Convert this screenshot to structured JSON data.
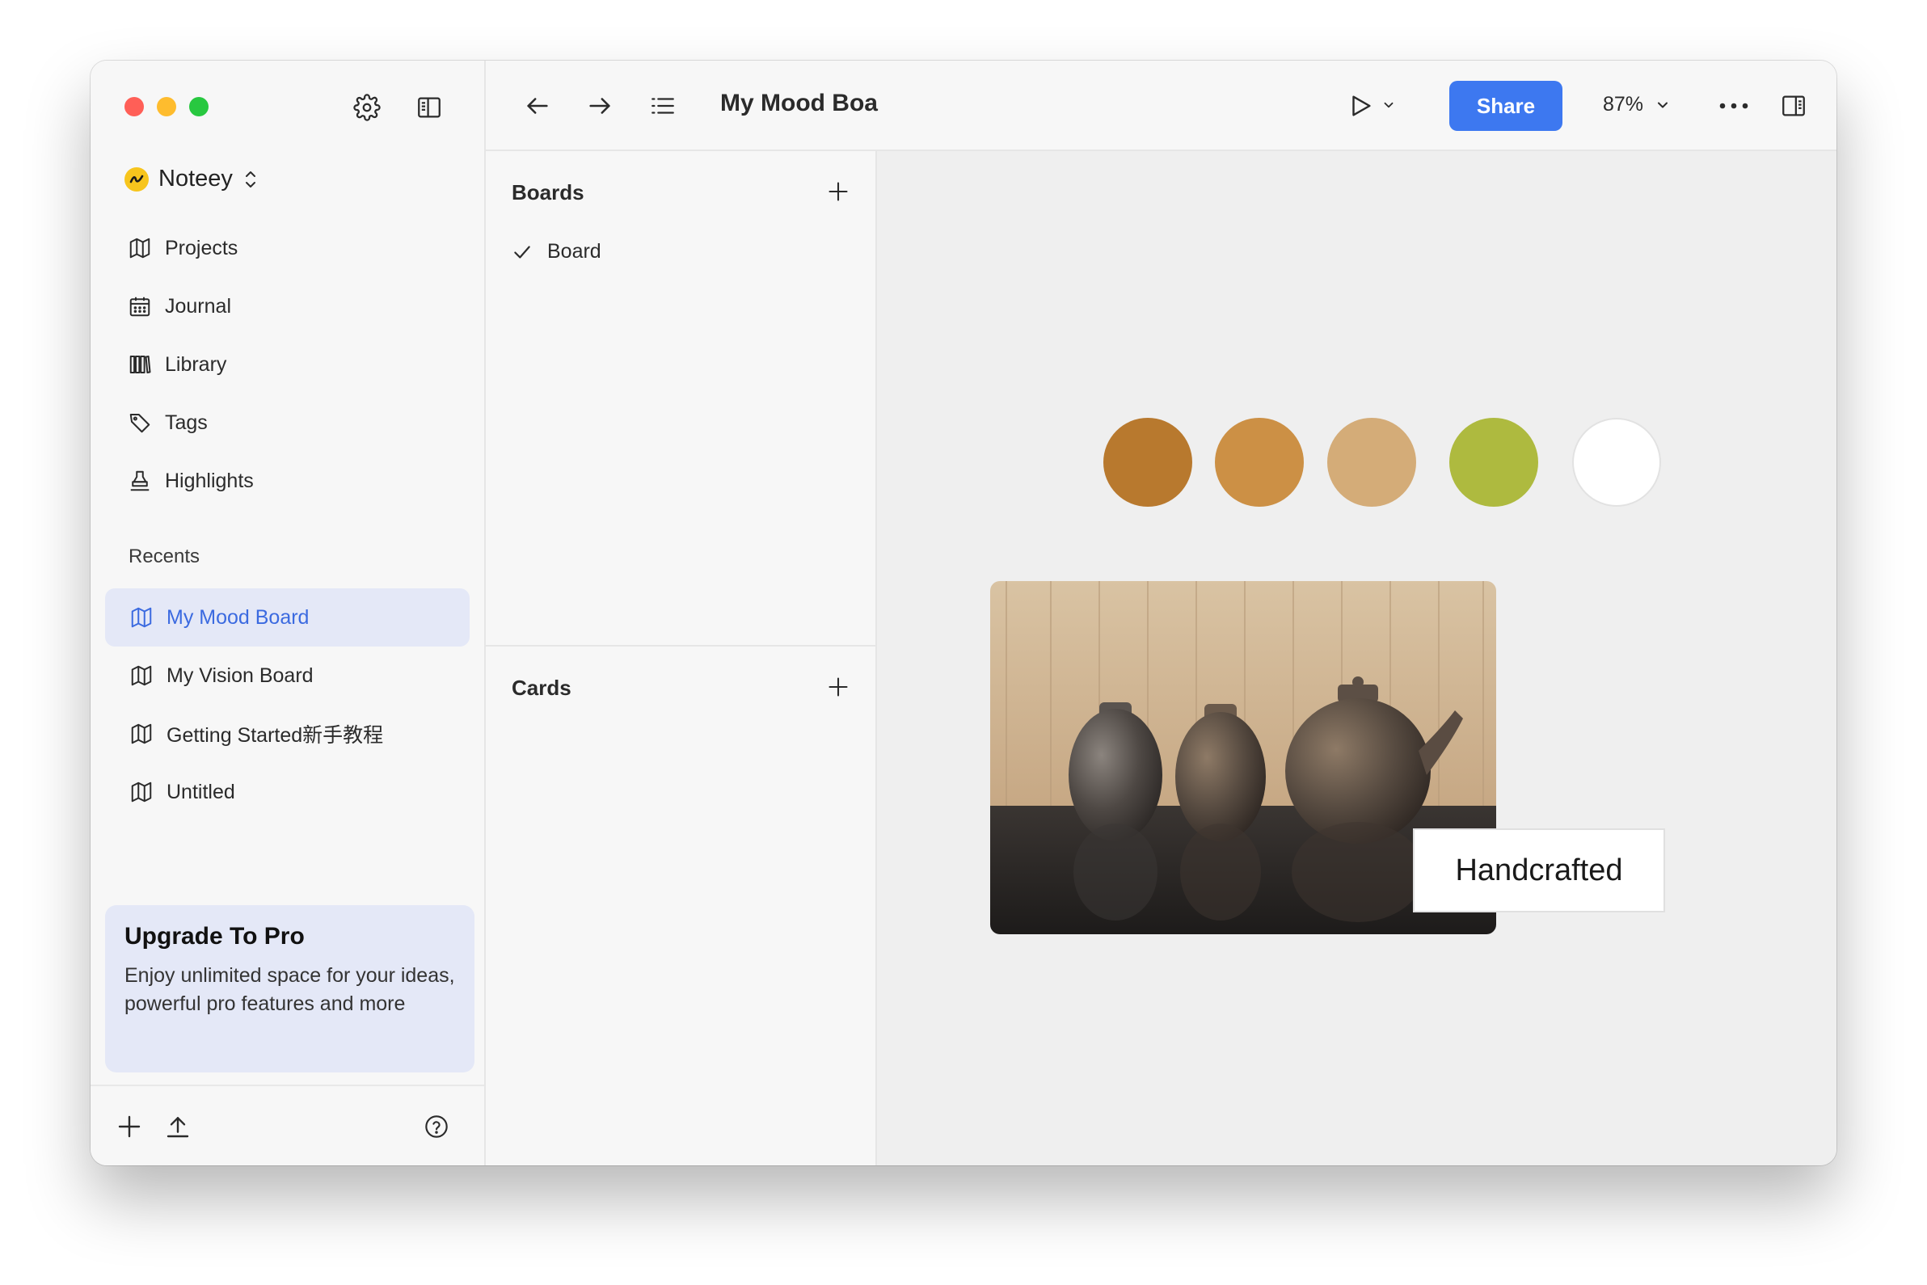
{
  "window": {
    "traffic_lights": [
      "close",
      "minimize",
      "zoom"
    ]
  },
  "sidebar": {
    "workspace_name": "Noteey",
    "nav_items": [
      {
        "label": "Projects",
        "icon": "map-icon"
      },
      {
        "label": "Journal",
        "icon": "calendar-icon"
      },
      {
        "label": "Library",
        "icon": "library-icon"
      },
      {
        "label": "Tags",
        "icon": "tag-icon"
      },
      {
        "label": "Highlights",
        "icon": "highlighter-icon"
      }
    ],
    "recents_label": "Recents",
    "recents": [
      {
        "label": "My Mood Board",
        "active": true
      },
      {
        "label": "My Vision Board",
        "active": false
      },
      {
        "label": "Getting Started新手教程",
        "active": false
      },
      {
        "label": "Untitled",
        "active": false
      }
    ],
    "upgrade": {
      "title": "Upgrade To Pro",
      "text": "Enjoy unlimited space for your ideas, powerful pro features and more"
    }
  },
  "toolbar": {
    "title": "My Mood Boa",
    "share_label": "Share",
    "zoom": "87%"
  },
  "boards_panel": {
    "boards_header": "Boards",
    "boards": [
      {
        "label": "Board",
        "checked": true
      }
    ],
    "cards_header": "Cards"
  },
  "canvas": {
    "swatches": [
      "#b8792e",
      "#cc9045",
      "#d4ac78",
      "#aeba3f",
      "#ffffff"
    ],
    "caption": "Handcrafted"
  },
  "colors": {
    "accent": "#3d78f0",
    "active_bg": "#e4e8f7",
    "active_text": "#3b6ae0"
  }
}
